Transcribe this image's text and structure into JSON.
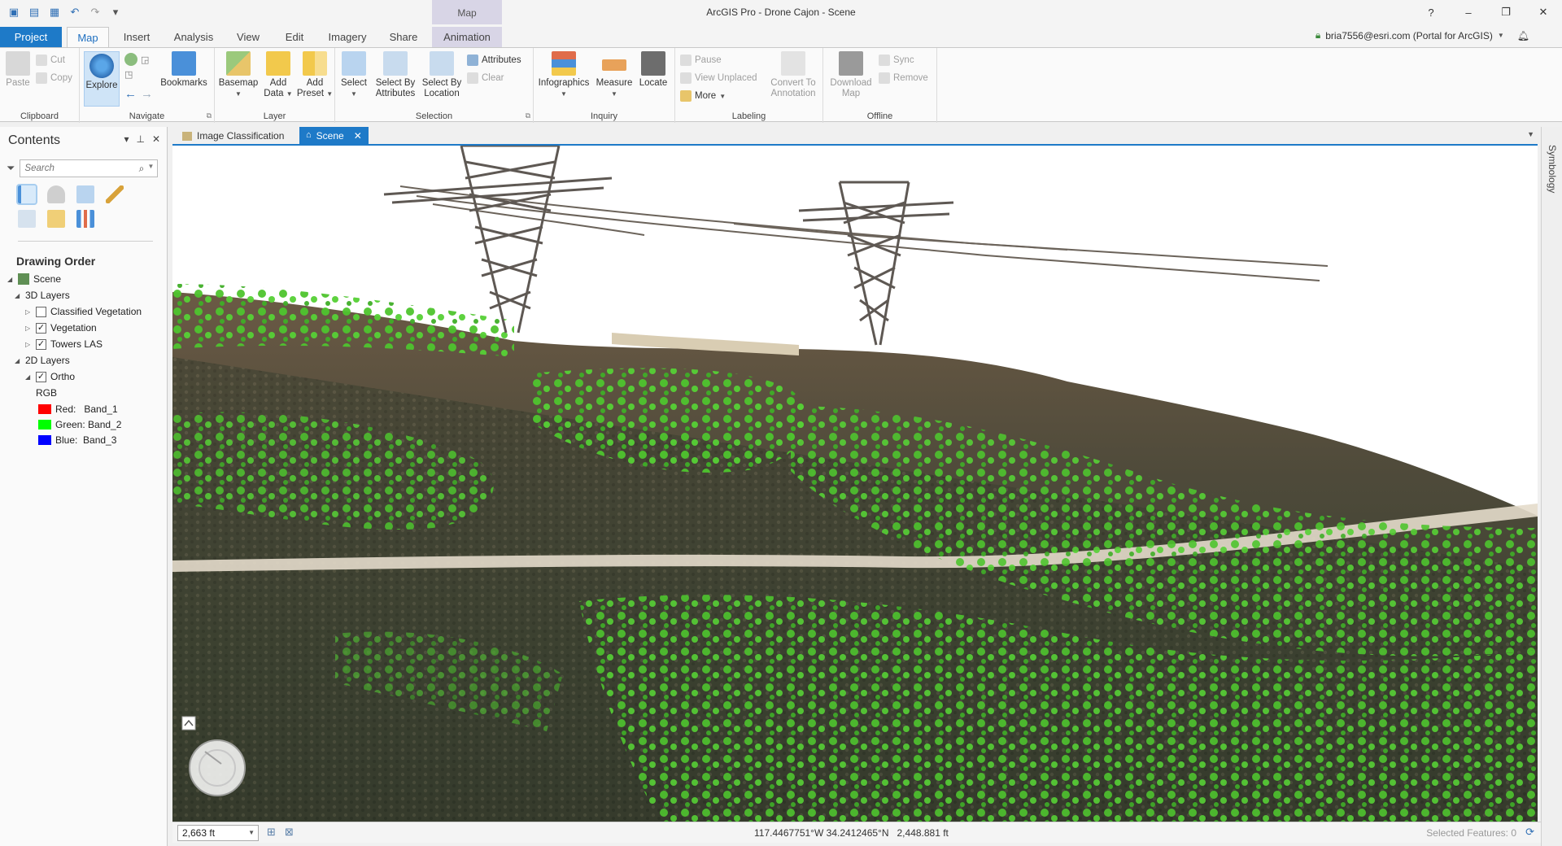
{
  "window": {
    "title": "ArcGIS Pro - Drone Cajon - Scene",
    "context_header": "Map",
    "controls": [
      "?",
      "–",
      "❐",
      "✕"
    ]
  },
  "tabs": [
    "Project",
    "Map",
    "Insert",
    "Analysis",
    "View",
    "Edit",
    "Imagery",
    "Share",
    "Animation"
  ],
  "user": {
    "label": "bria7556@esri.com (Portal for ArcGIS)"
  },
  "ribbon": {
    "clipboard": {
      "label": "Clipboard",
      "paste": "Paste",
      "cut": "Cut",
      "copy": "Copy"
    },
    "navigate": {
      "label": "Navigate",
      "explore": "Explore",
      "bookmarks": "Bookmarks"
    },
    "layer": {
      "label": "Layer",
      "basemap": "Basemap",
      "add_data_1": "Add",
      "add_data_2": "Data",
      "add_preset_1": "Add",
      "add_preset_2": "Preset"
    },
    "selection": {
      "label": "Selection",
      "select": "Select",
      "select_attr_1": "Select By",
      "select_attr_2": "Attributes",
      "select_loc_1": "Select By",
      "select_loc_2": "Location",
      "attributes": "Attributes",
      "clear": "Clear"
    },
    "inquiry": {
      "label": "Inquiry",
      "infographics": "Infographics",
      "measure": "Measure",
      "locate": "Locate"
    },
    "labeling": {
      "label": "Labeling",
      "pause": "Pause",
      "view_unplaced": "View Unplaced",
      "more": "More",
      "convert_1": "Convert To",
      "convert_2": "Annotation"
    },
    "offline": {
      "label": "Offline",
      "download_1": "Download",
      "download_2": "Map",
      "sync": "Sync",
      "remove": "Remove"
    }
  },
  "contents": {
    "title": "Contents",
    "search_placeholder": "Search",
    "heading": "Drawing Order",
    "tree": {
      "scene": "Scene",
      "layers_3d": "3D Layers",
      "classified_vegetation": "Classified Vegetation",
      "vegetation": "Vegetation",
      "towers_las": "Towers LAS",
      "layers_2d": "2D Layers",
      "ortho": "Ortho",
      "rgb": "RGB",
      "red": "Red:   Band_1",
      "green": "Green: Band_2",
      "blue": "Blue:  Band_3"
    },
    "checked": {
      "classified_vegetation": false,
      "vegetation": true,
      "towers_las": true,
      "ortho": true
    }
  },
  "doc_tabs": {
    "image_classification": "Image Classification",
    "scene": "Scene"
  },
  "right_dock": {
    "label": "Symbology"
  },
  "status": {
    "scale": "2,663 ft",
    "coordinates": "117.4467751°W 34.2412465°N   2,448.881 ft",
    "selected": "Selected Features: 0"
  },
  "colors": {
    "accent": "#1e7ac8",
    "context_tab": "#d8d5e6",
    "band_red": "#ff0000",
    "band_green": "#00ff00",
    "band_blue": "#0000ff",
    "vegetation_points": "#4ec42e"
  }
}
